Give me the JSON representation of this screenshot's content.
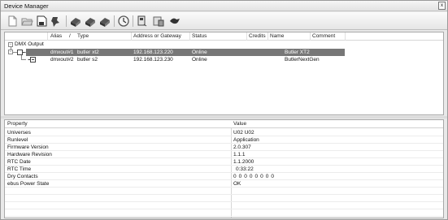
{
  "window": {
    "title": "Device Manager",
    "close_glyph": "x"
  },
  "toolbar": {
    "buttons": [
      {
        "icon": "new-page-icon"
      },
      {
        "icon": "open-folder-icon"
      },
      {
        "icon": "save-document-icon"
      },
      {
        "icon": "pin-icon"
      },
      {
        "icon": "device-tool-icon"
      },
      {
        "icon": "device-tool-icon"
      },
      {
        "icon": "device-tool-icon"
      },
      {
        "icon": "clock-icon"
      },
      {
        "icon": "device-config-icon"
      },
      {
        "icon": "device-settings-icon"
      },
      {
        "icon": "dmx-connector-icon"
      }
    ]
  },
  "device_tree": {
    "columns": [
      "Alias",
      "/",
      "Type",
      "Address or Gateway",
      "Status",
      "Credits",
      "Name",
      "Comment"
    ],
    "root_label": "DMX Output",
    "expander_root": "-",
    "expander_child": "-",
    "rows": [
      {
        "alias": "dmxout#1",
        "type": "butler xt2",
        "address": "192.168.123.220",
        "status": "Online",
        "credits": "",
        "name": "Butler XT2",
        "comment": "",
        "selected": true
      },
      {
        "alias": "dmxout#2",
        "type": "butler s2",
        "address": "192.168.123.230",
        "status": "Online",
        "credits": "",
        "name": "ButlerNextGen",
        "comment": "",
        "selected": false
      }
    ]
  },
  "properties": {
    "header_property": "Property",
    "header_value": "Value",
    "rows": [
      {
        "property": "Universes",
        "value": "U02 U02"
      },
      {
        "property": "Runlevel",
        "value": "Application"
      },
      {
        "property": "Firmware Version",
        "value": "2.0.307"
      },
      {
        "property": "Hardware Revision",
        "value": "1.1.1"
      },
      {
        "property": "RTC Date",
        "value": "1.1.2000"
      },
      {
        "property": "RTC Time",
        "value": "0:33:22"
      },
      {
        "property": "Dry Contacts",
        "value": "0 0 0 0 0 0 0 0"
      },
      {
        "property": "ebus Power State",
        "value": "OK"
      }
    ]
  },
  "colors": {
    "selection": "#777777",
    "pane_border": "#a8a8a8"
  }
}
